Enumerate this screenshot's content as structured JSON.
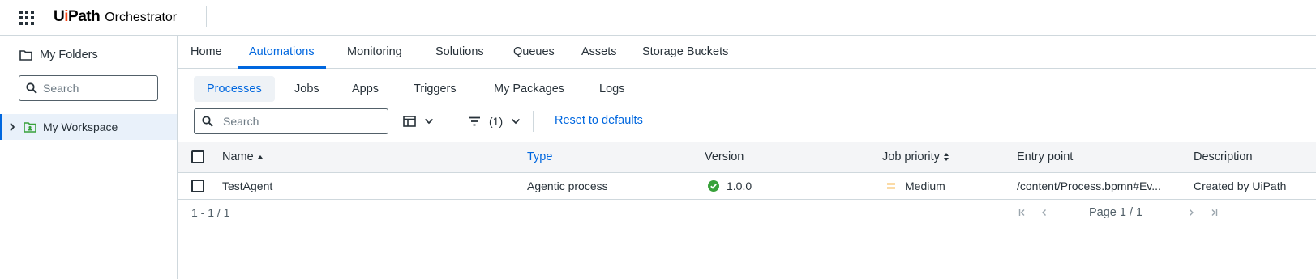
{
  "header": {
    "logo_ui": "Ui",
    "logo_path": "Path",
    "product": "Orchestrator"
  },
  "sidebar": {
    "title": "My Folders",
    "search_placeholder": "Search",
    "workspace_label": "My Workspace"
  },
  "main_tabs": [
    "Home",
    "Automations",
    "Monitoring",
    "Solutions",
    "Queues",
    "Assets",
    "Storage Buckets"
  ],
  "active_main_tab": "Automations",
  "sub_tabs": [
    "Processes",
    "Jobs",
    "Apps",
    "Triggers",
    "My Packages",
    "Logs"
  ],
  "active_sub_tab": "Processes",
  "toolbar": {
    "search_placeholder": "Search",
    "filter_count": "(1)",
    "reset_label": "Reset to defaults"
  },
  "table": {
    "columns": [
      "Name",
      "Type",
      "Version",
      "Job priority",
      "Entry point",
      "Description"
    ],
    "rows": [
      {
        "name": "TestAgent",
        "type": "Agentic process",
        "version": "1.0.0",
        "job_priority": "Medium",
        "entry_point": "/content/Process.bpmn#Ev...",
        "description": "Created by UiPath"
      }
    ]
  },
  "pagination": {
    "range": "1 - 1 / 1",
    "page_label": "Page 1 / 1"
  },
  "colors": {
    "accent": "#0067df",
    "brand_orange": "#fa4616",
    "status_success": "#38a13a",
    "priority_medium": "#f5a623"
  }
}
